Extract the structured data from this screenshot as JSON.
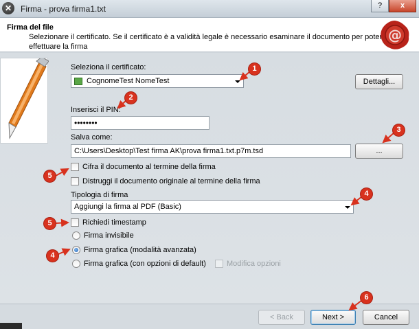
{
  "window": {
    "title": "Firma - prova firma1.txt",
    "help": "?",
    "close": "x"
  },
  "header": {
    "title": "Firma del file",
    "description": "Selezionare il certificato. Se il certificato è a validità legale è necessario esaminare il documento per poter effettuare la firma"
  },
  "certificate": {
    "label": "Seleziona il certificato:",
    "selected": "CognomeTest NomeTest",
    "details_button": "Dettagli..."
  },
  "pin": {
    "label": "Inserisci il PIN:",
    "value": "••••••••"
  },
  "save": {
    "label": "Salva come:",
    "path": "C:\\Users\\Desktop\\Test firma AK\\prova firma1.txt.p7m.tsd",
    "browse_button": "..."
  },
  "options": {
    "encrypt": "Cifra il documento al termine della firma",
    "destroy": "Distruggi il documento originale al termine della firma"
  },
  "signature_type": {
    "label": "Tipologia di firma",
    "selected": "Aggiungi la firma al PDF (Basic)"
  },
  "timestamp": {
    "label": "Richiedi timestamp"
  },
  "radios": {
    "invisible": "Firma invisibile",
    "graphic_advanced": "Firma grafica (modalità avanzata)",
    "graphic_default": "Firma grafica (con opzioni di default)",
    "modify_options": "Modifica opzioni",
    "selected": "graphic_advanced"
  },
  "footer": {
    "back": "< Back",
    "next": "Next >",
    "cancel": "Cancel"
  },
  "annotations": {
    "b1": "1",
    "b2": "2",
    "b3": "3",
    "b4": "4",
    "b5a": "5",
    "b5b": "5",
    "b6": "6"
  },
  "colors": {
    "annotation": "#d8321e",
    "seal": "#b8231a"
  }
}
